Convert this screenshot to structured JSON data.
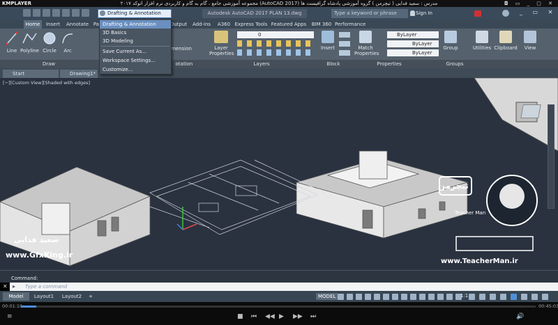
{
  "player": {
    "logo": "KMPLAYER",
    "title": "مجموعه آموزشی جامع ، گام به گام و کاربردی نرم افزار   اتوکد ٢٠١٧ (AutoCAD 2017)   مدرس : سعید فدایی ( تیچرمن ) گروه آموزشی پادشاه گرافیست ها",
    "window_controls": "◘ ▭ _ ▢ ✕",
    "time_current": "00:01:10",
    "time_total": "00:45:03"
  },
  "acad": {
    "app_logo": "A",
    "workspace_current": "Drafting & Annotation",
    "doc_title": "Autodesk AutoCAD 2017   PLAN 13.dwg",
    "search_placeholder": "Type a keyword or phrase",
    "signin": "Sign In",
    "ribbon_tabs": [
      "Home",
      "Insert",
      "Annotate",
      "Pa",
      "Output",
      "Add-ins",
      "A360",
      "Express Tools",
      "Featured Apps",
      "BIM 360",
      "Performance"
    ],
    "ribbon_panels": [
      "Draw",
      "otation",
      "Layers",
      "Block",
      "Properties",
      "Groups"
    ],
    "draw_tools": [
      "Line",
      "Polyline",
      "Circle",
      "Arc"
    ],
    "tool_labels": {
      "dimension": "mension",
      "layer_properties": "Layer Properties",
      "insert": "Insert",
      "match_properties": "Match Properties",
      "group": "Group",
      "utilities": "Utilities",
      "clipboard": "Clipboard",
      "view": "View"
    },
    "bylayer": [
      "ByLayer",
      "ByLayer",
      "ByLayer"
    ],
    "layer_current": "0",
    "file_tabs": [
      "Start",
      "Drawing1*"
    ],
    "viewport_caption": "[−][Custom View][Shaded with edges]",
    "workspace_menu": {
      "items": [
        "Drafting & Annotation",
        "3D Basics",
        "3D Modeling",
        "Save Current As...",
        "Workspace Settings...",
        "Customize..."
      ],
      "selected": 0
    },
    "command_label": "Command:",
    "command_placeholder": "Type  a  command",
    "layout_tabs": [
      "Model",
      "Layout1",
      "Layout2"
    ],
    "add_layout": "+",
    "status_model": "MODEL",
    "status_scale": "1:1"
  },
  "watermarks": {
    "brand_fa": "تیچرمن",
    "brand_en": "Teacher Man",
    "url": "www.TeacherMan.ir",
    "site": "www.GfxKing.ir",
    "author_fa": "سعید فدایی"
  },
  "colors": {
    "viewport_bg": "#2a3240",
    "menu_highlight": "#6a8fc0",
    "acad_red": "#c8272e"
  }
}
